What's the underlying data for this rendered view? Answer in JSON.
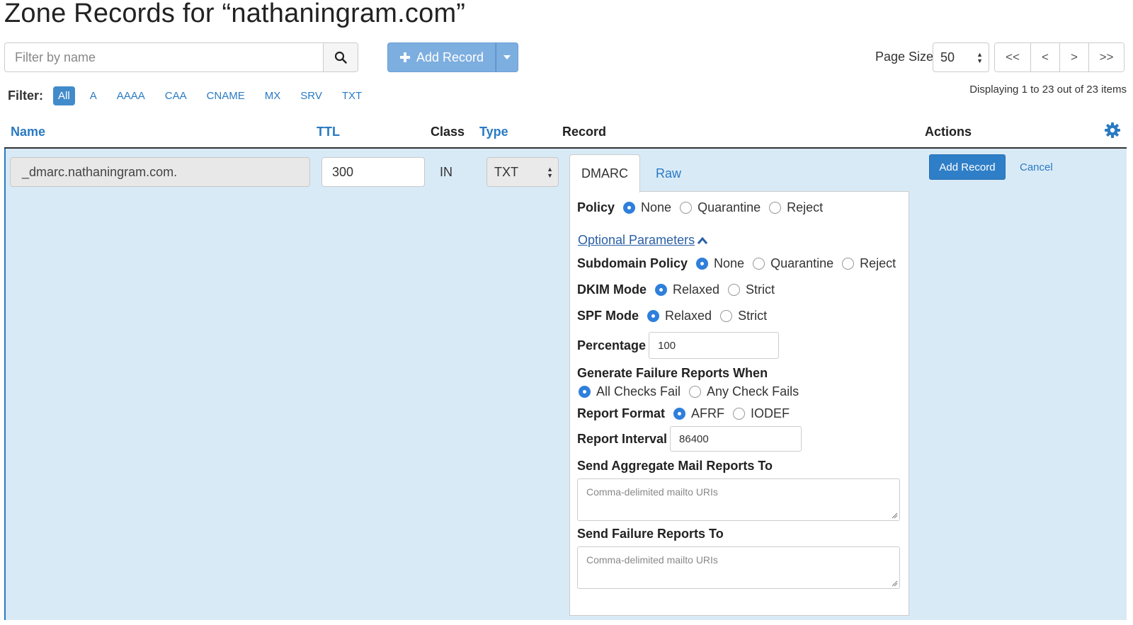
{
  "page": {
    "title": "Zone Records for “nathaningram.com”"
  },
  "search": {
    "placeholder": "Filter by name"
  },
  "toolbar": {
    "add_record_label": "Add Record"
  },
  "pagination": {
    "page_size_label": "Page Size",
    "page_size_value": "50",
    "first": "<<",
    "prev": "<",
    "next": ">",
    "last": ">>",
    "displaying": "Displaying 1 to 23 out of 23 items"
  },
  "filter": {
    "label": "Filter:",
    "options": [
      "All",
      "A",
      "AAAA",
      "CAA",
      "CNAME",
      "MX",
      "SRV",
      "TXT"
    ],
    "active": "All"
  },
  "table": {
    "headers": {
      "name": "Name",
      "ttl": "TTL",
      "class": "Class",
      "type": "Type",
      "record": "Record",
      "actions": "Actions"
    }
  },
  "edit_row": {
    "name": "_dmarc.nathaningram.com.",
    "ttl": "300",
    "class": "IN",
    "type": "TXT",
    "tabs": [
      "DMARC",
      "Raw"
    ],
    "active_tab": "DMARC",
    "add_record_button": "Add Record",
    "cancel_link": "Cancel"
  },
  "dmarc": {
    "policy": {
      "label": "Policy",
      "options": [
        "None",
        "Quarantine",
        "Reject"
      ],
      "selected": "None"
    },
    "optional_parameters_link": "Optional Parameters",
    "subdomain_policy": {
      "label": "Subdomain Policy",
      "options": [
        "None",
        "Quarantine",
        "Reject"
      ],
      "selected": "None"
    },
    "dkim_mode": {
      "label": "DKIM Mode",
      "options": [
        "Relaxed",
        "Strict"
      ],
      "selected": "Relaxed"
    },
    "spf_mode": {
      "label": "SPF Mode",
      "options": [
        "Relaxed",
        "Strict"
      ],
      "selected": "Relaxed"
    },
    "percentage": {
      "label": "Percentage",
      "value": "100"
    },
    "failure_reports": {
      "label": "Generate Failure Reports When",
      "options": [
        "All Checks Fail",
        "Any Check Fails"
      ],
      "selected": "All Checks Fail"
    },
    "report_format": {
      "label": "Report Format",
      "options": [
        "AFRF",
        "IODEF"
      ],
      "selected": "AFRF"
    },
    "report_interval": {
      "label": "Report Interval",
      "value": "86400"
    },
    "aggregate": {
      "label": "Send Aggregate Mail Reports To",
      "placeholder": "Comma-delimited mailto URIs"
    },
    "failure_to": {
      "label": "Send Failure Reports To",
      "placeholder": "Comma-delimited mailto URIs"
    }
  },
  "colors": {
    "accent": "#2a7ac2",
    "row_highlight": "#d9eaf7",
    "radio_selected": "#2f7fdc"
  }
}
